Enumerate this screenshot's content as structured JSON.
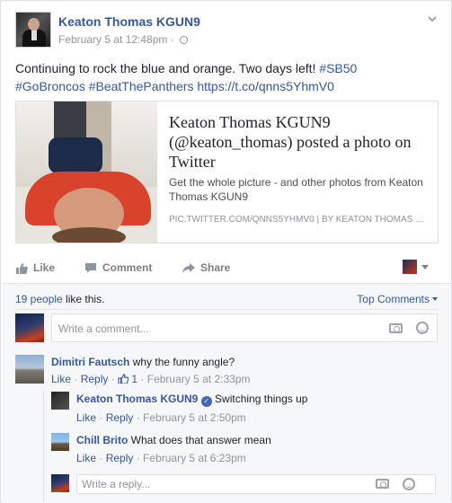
{
  "post": {
    "author": "Keaton Thomas KGUN9",
    "timestamp": "February 5 at 12:48pm",
    "meta_sep": "·",
    "text_plain": "Continuing to rock the blue and orange. Two days left!",
    "hashtag1": "#SB50",
    "hashtag2": "#GoBroncos",
    "hashtag3": "#BeatThePanthers",
    "link_text": "https://t.co/qnns5YhmV0"
  },
  "link_preview": {
    "title": "Keaton Thomas KGUN9 (@keaton_thomas) posted a photo on Twitter",
    "description": "Get the whole picture - and other photos from Keaton Thomas KGUN9",
    "source": "pic.twitter.com/qnns5YhmV0 | By Keaton Thomas KGUN9"
  },
  "actions": {
    "like": "Like",
    "comment": "Comment",
    "share": "Share"
  },
  "social": {
    "likes_count": "19 people",
    "likes_suffix": " like this.",
    "top_comments": "Top Comments"
  },
  "composer": {
    "comment_placeholder": "Write a comment...",
    "reply_placeholder": "Write a reply..."
  },
  "comments": [
    {
      "name": "Dimitri Fautsch",
      "text": "why the funny angle?",
      "like": "Like",
      "reply": "Reply",
      "like_count": "1",
      "time": "February 5 at 2:33pm"
    }
  ],
  "replies": [
    {
      "name": "Keaton Thomas KGUN9",
      "text": "Switching things up",
      "like": "Like",
      "reply": "Reply",
      "time": "February 5 at 2:50pm"
    },
    {
      "name": "Chill Brito",
      "text": "What does that answer mean",
      "like": "Like",
      "reply": "Reply",
      "time": "February 5 at 6:23pm"
    }
  ],
  "colors": {
    "link": "#365899",
    "meta": "#90949c",
    "action": "#7f7f7f"
  }
}
